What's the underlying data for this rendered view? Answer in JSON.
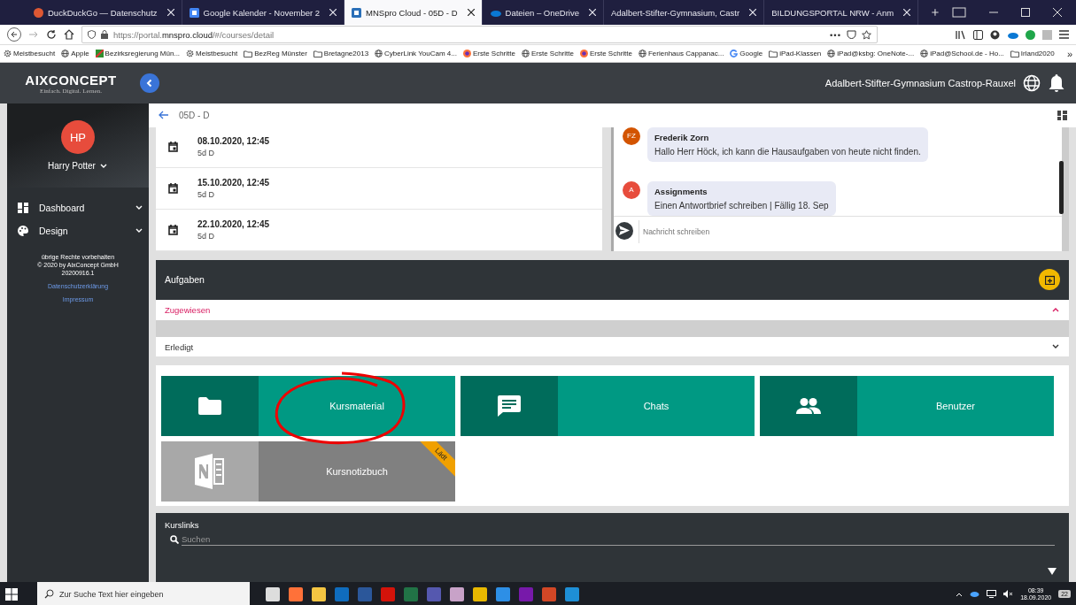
{
  "browser": {
    "tabs": [
      {
        "title": "DuckDuckGo — Datenschutz",
        "kind": "duck",
        "selected": false
      },
      {
        "title": "Google Kalender - November 2",
        "kind": "calendar",
        "selected": false
      },
      {
        "title": "MNSpro Cloud - 05D - D",
        "kind": "mnspro",
        "selected": true
      },
      {
        "title": "Dateien – OneDrive",
        "kind": "cloud",
        "selected": false
      },
      {
        "title": "Adalbert-Stifter-Gymnasium, Castr",
        "kind": "plain",
        "selected": false
      },
      {
        "title": "BILDUNGSPORTAL NRW - Anm",
        "kind": "plain",
        "selected": false
      }
    ],
    "url_prefix": "https://portal.",
    "url_domain": "mnspro.cloud",
    "url_path": "/#/courses/detail",
    "url_menu": "•••",
    "bookmarks": [
      {
        "label": "Meistbesucht",
        "kind": "gear"
      },
      {
        "label": "Apple",
        "kind": "globe"
      },
      {
        "label": "Bezirksregierung Mün...",
        "kind": "site"
      },
      {
        "label": "Meistbesucht",
        "kind": "gear"
      },
      {
        "label": "BezReg Münster",
        "kind": "folder"
      },
      {
        "label": "Bretagne2013",
        "kind": "folder"
      },
      {
        "label": "CyberLink YouCam 4...",
        "kind": "globe"
      },
      {
        "label": "Erste Schritte",
        "kind": "firefox"
      },
      {
        "label": "Erste Schritte",
        "kind": "globe"
      },
      {
        "label": "Erste Schritte",
        "kind": "firefox"
      },
      {
        "label": "Ferienhaus Cappanac...",
        "kind": "globe"
      },
      {
        "label": "Google",
        "kind": "google"
      },
      {
        "label": "iPad-Klassen",
        "kind": "folder"
      },
      {
        "label": "iPad@ksbg: OneNote-...",
        "kind": "globe"
      },
      {
        "label": "iPad@School.de - Ho...",
        "kind": "globe"
      },
      {
        "label": "Irland2020",
        "kind": "folder"
      }
    ],
    "bookmarks_more": "»"
  },
  "app": {
    "logo": "AIXCONCEPT",
    "tagline": "Einfach. Digital. Lernen.",
    "school": "Adalbert-Stifter-Gymnasium Castrop-Rauxel",
    "user": {
      "initials": "HP",
      "name": "Harry Potter"
    },
    "nav": [
      {
        "label": "Dashboard",
        "kind": "dashboard"
      },
      {
        "label": "Design",
        "kind": "palette"
      }
    ],
    "footer": [
      "übrige Rechte vorbehalten",
      "© 2020 by AixConcept GmbH",
      "20200916.1"
    ],
    "links": [
      "Datenschutzerklärung",
      "Impressum"
    ]
  },
  "course": {
    "title": "05D - D",
    "events": [
      {
        "date": "08.10.2020, 12:45",
        "group": "5d D"
      },
      {
        "date": "15.10.2020, 12:45",
        "group": "5d D"
      },
      {
        "date": "22.10.2020, 12:45",
        "group": "5d D"
      }
    ],
    "messages": [
      {
        "initials": "FZ",
        "author": "Frederik Zorn",
        "text": "Hallo Herr Höck, ich kann die Hausaufgaben von heute nicht finden.",
        "color": "#d35400"
      },
      {
        "initials": "A",
        "author": "Assignments",
        "text": "Einen Antwortbrief schreiben | Fällig 18. Sep",
        "color": "#e74c3c"
      }
    ],
    "chat_placeholder": "Nachricht schreiben"
  },
  "tasks": {
    "title": "Aufgaben",
    "sections": [
      {
        "label": "Zugewiesen",
        "expanded": true
      },
      {
        "label": "Erledigt",
        "expanded": false
      }
    ]
  },
  "tiles": [
    {
      "label": "Kursmaterial",
      "kind": "folder"
    },
    {
      "label": "Chats",
      "kind": "chat"
    },
    {
      "label": "Benutzer",
      "kind": "users"
    },
    {
      "label": "Kursnotizbuch",
      "kind": "onenote",
      "badge": "Lädt"
    }
  ],
  "kurslinks": {
    "title": "Kurslinks",
    "placeholder": "Suchen"
  },
  "taskbar": {
    "search_placeholder": "Zur Suche Text hier eingeben",
    "apps": [
      {
        "kind": "taskview"
      },
      {
        "kind": "firefox"
      },
      {
        "kind": "explorer"
      },
      {
        "kind": "outlook"
      },
      {
        "kind": "word"
      },
      {
        "kind": "acrobat"
      },
      {
        "kind": "excel"
      },
      {
        "kind": "teams"
      },
      {
        "kind": "paint"
      },
      {
        "kind": "tool"
      },
      {
        "kind": "calendar"
      },
      {
        "kind": "onenote"
      },
      {
        "kind": "powerpoint"
      },
      {
        "kind": "window"
      }
    ],
    "time": "08:39",
    "date": "18.09.2020",
    "notifications": "22"
  }
}
